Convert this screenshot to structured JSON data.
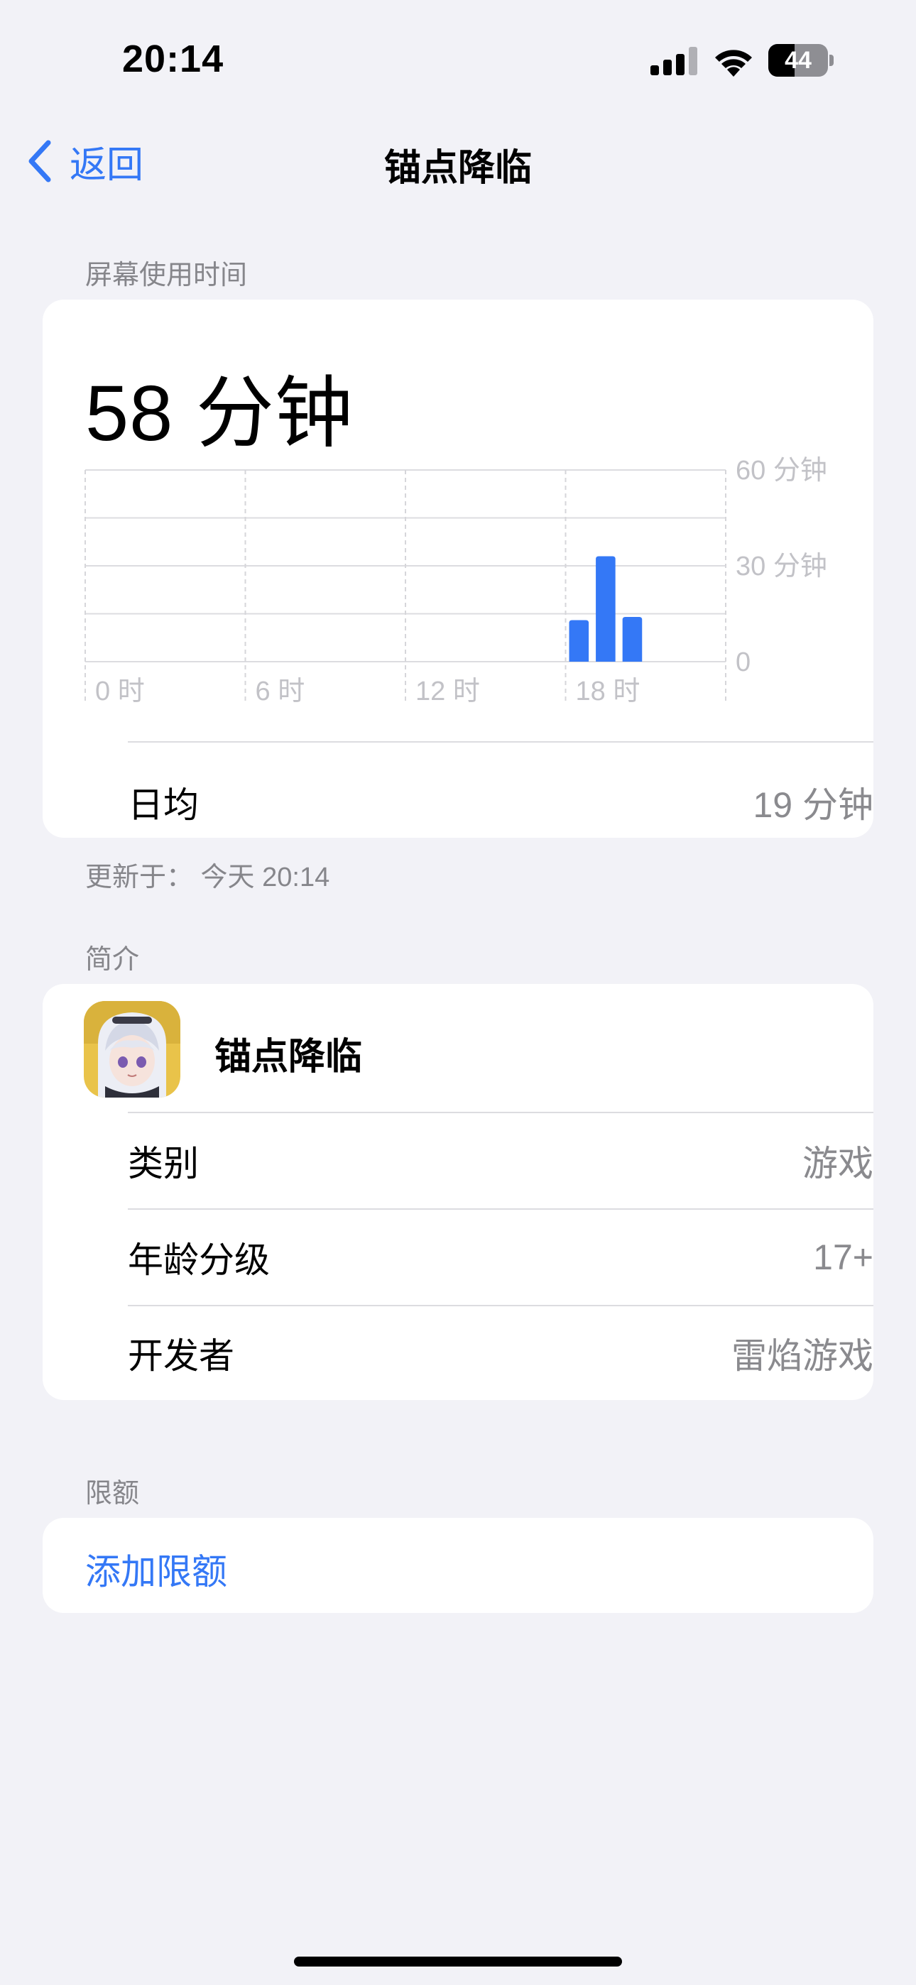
{
  "status_bar": {
    "time": "20:14",
    "battery": "44",
    "battery_level": 0.44
  },
  "nav": {
    "back_label": "返回",
    "title": "锚点降临"
  },
  "screen_time": {
    "section_label": "屏幕使用时间",
    "total": "58 分钟",
    "daily_average_label": "日均",
    "daily_average_value": "19 分钟",
    "updated": "更新于： 今天 20:14"
  },
  "chart_data": {
    "type": "bar",
    "x_tick_labels": [
      "0 时",
      "6 时",
      "12 时",
      "18 时"
    ],
    "y_tick_labels": [
      "60 分钟",
      "30 分钟",
      "0"
    ],
    "ylim": [
      0,
      60
    ],
    "hours": [
      18,
      19,
      20
    ],
    "values": [
      13,
      33,
      14
    ],
    "bar_color": "#3478f6",
    "grid": true
  },
  "intro": {
    "section_label": "简介",
    "app_name": "锚点降临",
    "rows": [
      {
        "label": "类别",
        "value": "游戏"
      },
      {
        "label": "年龄分级",
        "value": "17+"
      },
      {
        "label": "开发者",
        "value": "雷焰游戏"
      }
    ]
  },
  "limits": {
    "section_label": "限额",
    "add_label": "添加限额"
  },
  "colors": {
    "accent": "#3478f6",
    "background": "#f2f2f7",
    "secondary_text": "#86868b"
  }
}
